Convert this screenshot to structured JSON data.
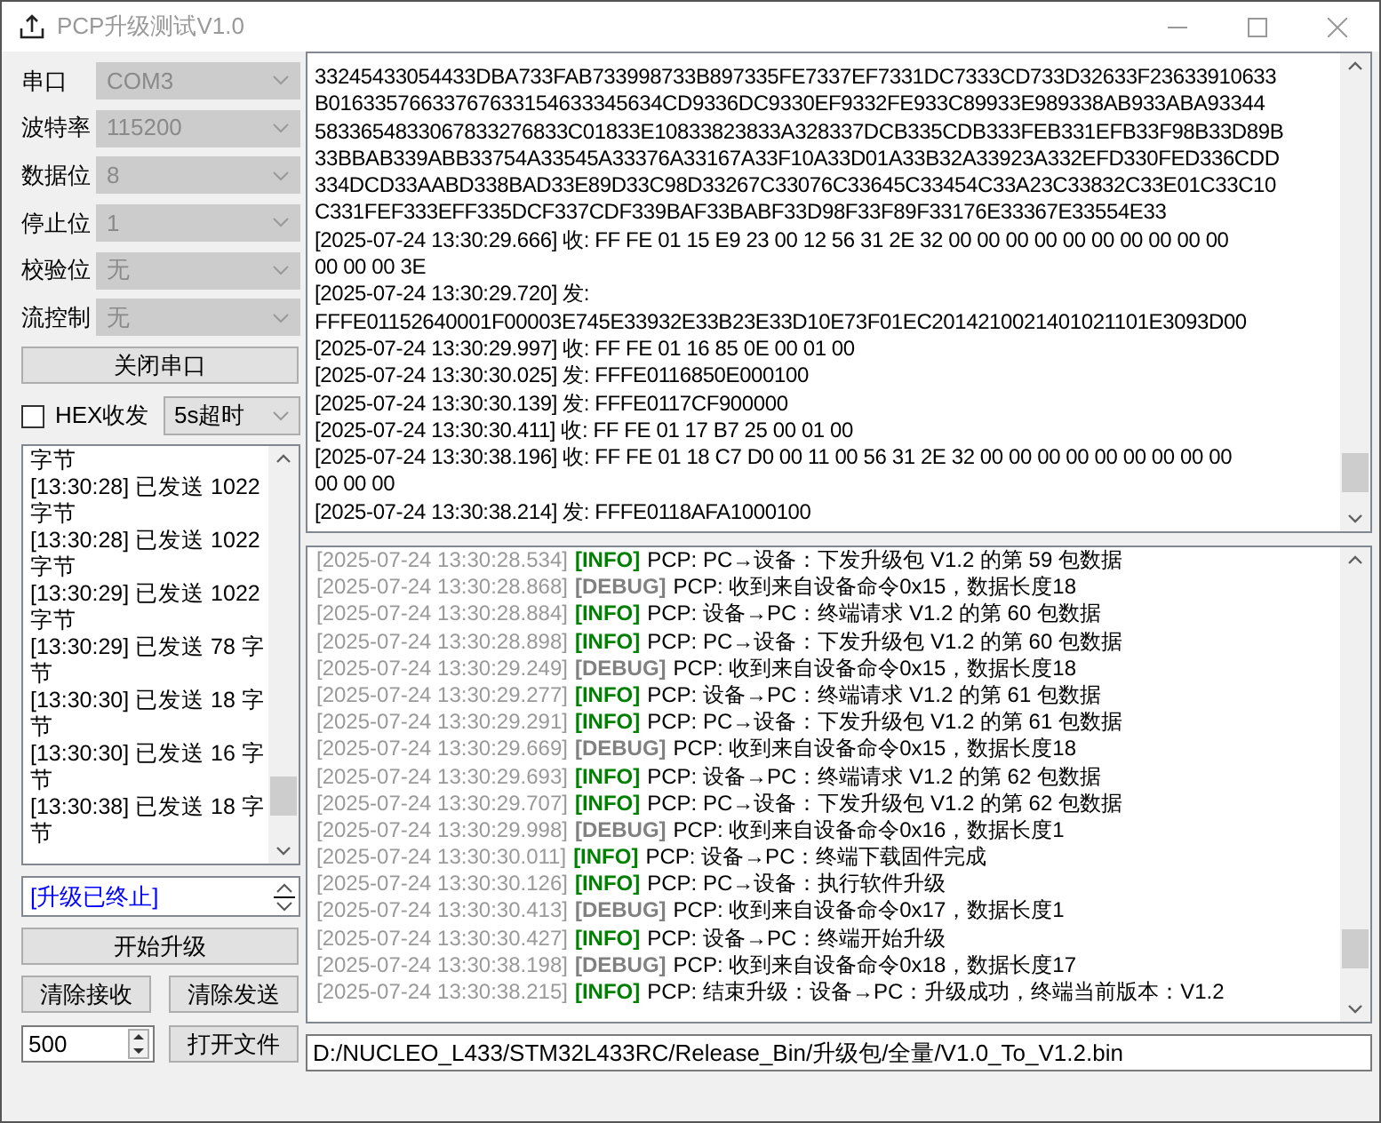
{
  "window": {
    "title": "PCP升级测试V1.0"
  },
  "settings": [
    {
      "label": "串口",
      "value": "COM3",
      "disabled": true
    },
    {
      "label": "波特率",
      "value": "115200",
      "disabled": true
    },
    {
      "label": "数据位",
      "value": "8",
      "disabled": true
    },
    {
      "label": "停止位",
      "value": "1",
      "disabled": true
    },
    {
      "label": "校验位",
      "value": "无",
      "disabled": true
    },
    {
      "label": "流控制",
      "value": "无",
      "disabled": true
    }
  ],
  "close_port_button": "关闭串口",
  "hex_checkbox": {
    "label": "HEX收发",
    "checked": false
  },
  "timeout_select": {
    "value": "5s超时"
  },
  "send_log": [
    "字节",
    "[13:30:28] 已发送 1022",
    "字节",
    "[13:30:28] 已发送 1022",
    "字节",
    "[13:30:29] 已发送 1022",
    "字节",
    "[13:30:29] 已发送 78 字",
    "节",
    "[13:30:30] 已发送 18 字",
    "节",
    "[13:30:30] 已发送 16 字",
    "节",
    "[13:30:38] 已发送 18 字",
    "节"
  ],
  "status_field": {
    "value": "[升级已终止]"
  },
  "start_button": "开始升级",
  "clear_receive_button": "清除接收",
  "clear_send_button": "清除发送",
  "interval_field": {
    "value": "500"
  },
  "open_file_button": "打开文件",
  "raw_log": [
    "33245433054433DBA733FAB733998733B897335FE7337EF7331DC7333CD733D32633F23633910633",
    "B01633576633767633154633345634CD9336DC9330EF9332FE933C89933E989338AB933ABA93344",
    "5833654833067833276833C01833E10833823833A328337DCB335CDB333FEB331EFB33F98B33D89B",
    "33BBAB339ABB33754A33545A33376A33167A33F10A33D01A33B32A33923A332EFD330FED336CDD",
    "334DCD33AABD338BAD33E89D33C98D33267C33076C33645C33454C33A23C33832C33E01C33C10",
    "C331FEF333EFF335DCF337CDF339BAF33BABF33D98F33F89F33176E33367E33554E33",
    "[2025-07-24 13:30:29.666] 收: FF FE 01 15 E9 23 00 12 56 31 2E 32 00 00 00 00 00 00 00 00 00 00",
    "00 00 00 3E",
    "[2025-07-24 13:30:29.720] 发:",
    "FFFE01152640001F00003E745E33932E33B23E33D10E73F01EC2014210021401021101E3093D00",
    "[2025-07-24 13:30:29.997] 收: FF FE 01 16 85 0E 00 01 00",
    "[2025-07-24 13:30:30.025] 发: FFFE0116850E000100",
    "[2025-07-24 13:30:30.139] 发: FFFE0117CF900000",
    "[2025-07-24 13:30:30.411] 收: FF FE 01 17 B7 25 00 01 00",
    "[2025-07-24 13:30:38.196] 收: FF FE 01 18 C7 D0 00 11 00 56 31 2E 32 00 00 00 00 00 00 00 00 00",
    "00 00 00",
    "[2025-07-24 13:30:38.214] 发: FFFE0118AFA1000100"
  ],
  "log": [
    {
      "time": "[2025-07-24 13:30:28.534]",
      "kind": "info",
      "tag": "[INFO]",
      "message": "PCP: PC→设备：下发升级包 V1.2 的第 59 包数据"
    },
    {
      "time": "[2025-07-24 13:30:28.868]",
      "kind": "debug",
      "tag": "[DEBUG]",
      "message": "PCP: 收到来自设备命令0x15，数据长度18"
    },
    {
      "time": "[2025-07-24 13:30:28.884]",
      "kind": "info",
      "tag": "[INFO]",
      "message": "PCP: 设备→PC：终端请求 V1.2 的第 60 包数据"
    },
    {
      "time": "[2025-07-24 13:30:28.898]",
      "kind": "info",
      "tag": "[INFO]",
      "message": "PCP: PC→设备：下发升级包 V1.2 的第 60 包数据"
    },
    {
      "time": "[2025-07-24 13:30:29.249]",
      "kind": "debug",
      "tag": "[DEBUG]",
      "message": "PCP: 收到来自设备命令0x15，数据长度18"
    },
    {
      "time": "[2025-07-24 13:30:29.277]",
      "kind": "info",
      "tag": "[INFO]",
      "message": "PCP: 设备→PC：终端请求 V1.2 的第 61 包数据"
    },
    {
      "time": "[2025-07-24 13:30:29.291]",
      "kind": "info",
      "tag": "[INFO]",
      "message": "PCP: PC→设备：下发升级包 V1.2 的第 61 包数据"
    },
    {
      "time": "[2025-07-24 13:30:29.669]",
      "kind": "debug",
      "tag": "[DEBUG]",
      "message": "PCP: 收到来自设备命令0x15，数据长度18"
    },
    {
      "time": "[2025-07-24 13:30:29.693]",
      "kind": "info",
      "tag": "[INFO]",
      "message": "PCP: 设备→PC：终端请求 V1.2 的第 62 包数据"
    },
    {
      "time": "[2025-07-24 13:30:29.707]",
      "kind": "info",
      "tag": "[INFO]",
      "message": "PCP: PC→设备：下发升级包 V1.2 的第 62 包数据"
    },
    {
      "time": "[2025-07-24 13:30:29.998]",
      "kind": "debug",
      "tag": "[DEBUG]",
      "message": "PCP: 收到来自设备命令0x16，数据长度1"
    },
    {
      "time": "[2025-07-24 13:30:30.011]",
      "kind": "info",
      "tag": "[INFO]",
      "message": "PCP: 设备→PC：终端下载固件完成"
    },
    {
      "time": "[2025-07-24 13:30:30.126]",
      "kind": "info",
      "tag": "[INFO]",
      "message": "PCP: PC→设备：执行软件升级"
    },
    {
      "time": "[2025-07-24 13:30:30.413]",
      "kind": "debug",
      "tag": "[DEBUG]",
      "message": "PCP: 收到来自设备命令0x17，数据长度1"
    },
    {
      "time": "[2025-07-24 13:30:30.427]",
      "kind": "info",
      "tag": "[INFO]",
      "message": "PCP: 设备→PC：终端开始升级"
    },
    {
      "time": "[2025-07-24 13:30:38.198]",
      "kind": "debug",
      "tag": "[DEBUG]",
      "message": "PCP: 收到来自设备命令0x18，数据长度17"
    },
    {
      "time": "[2025-07-24 13:30:38.215]",
      "kind": "info",
      "tag": "[INFO]",
      "message": "PCP: 结束升级：设备→PC：升级成功，终端当前版本：V1.2"
    }
  ],
  "file_path": {
    "value": "D:/NUCLEO_L433/STM32L433RC/Release_Bin/升级包/全量/V1.0_To_V1.2.bin"
  }
}
